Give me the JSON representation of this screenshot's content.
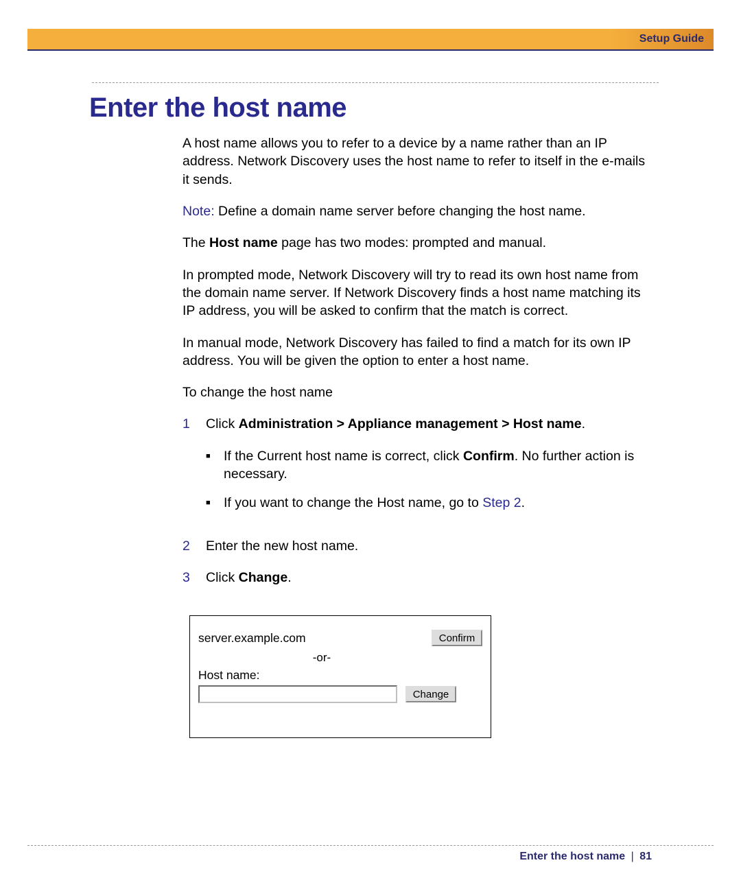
{
  "header": {
    "guide": "Setup Guide"
  },
  "heading": "Enter the host name",
  "para1": "A host name allows you to refer to a device by a name rather than an IP address. Network Discovery uses the host name to refer to itself in the e-mails it sends.",
  "note_label": "Note:",
  "note_text": " Define a domain name server before changing the host name.",
  "para2a": "The ",
  "para2b": "Host name",
  "para2c": " page has two modes: prompted and manual.",
  "para3": "In prompted mode, Network Discovery will try to read its own host name from the domain name server. If Network Discovery finds a host name matching its IP address, you will be asked to confirm that the match is correct.",
  "para4": "In manual mode, Network Discovery has failed to find a match for its own IP address. You will be given the option to enter a host name.",
  "para5": "To change the host name",
  "steps": {
    "s1": {
      "num": "1",
      "prefix": "Click ",
      "bold": "Administration > Appliance management > Host name",
      "suffix": ".",
      "bullet1a": "If the Current host name is correct, click ",
      "bullet1b": "Confirm",
      "bullet1c": ". No further action is necessary.",
      "bullet2a": "If you want to change the Host name, go to ",
      "bullet2b": "Step 2",
      "bullet2c": "."
    },
    "s2": {
      "num": "2",
      "text": "Enter the new host name."
    },
    "s3": {
      "num": "3",
      "prefix": "Click ",
      "bold": "Change",
      "suffix": "."
    }
  },
  "dialog": {
    "current": "server.example.com",
    "confirm": "Confirm",
    "or": "-or-",
    "label": "Host name:",
    "input_value": "",
    "change": "Change"
  },
  "footer": {
    "title": "Enter the host name",
    "sep": "|",
    "page": "81"
  }
}
